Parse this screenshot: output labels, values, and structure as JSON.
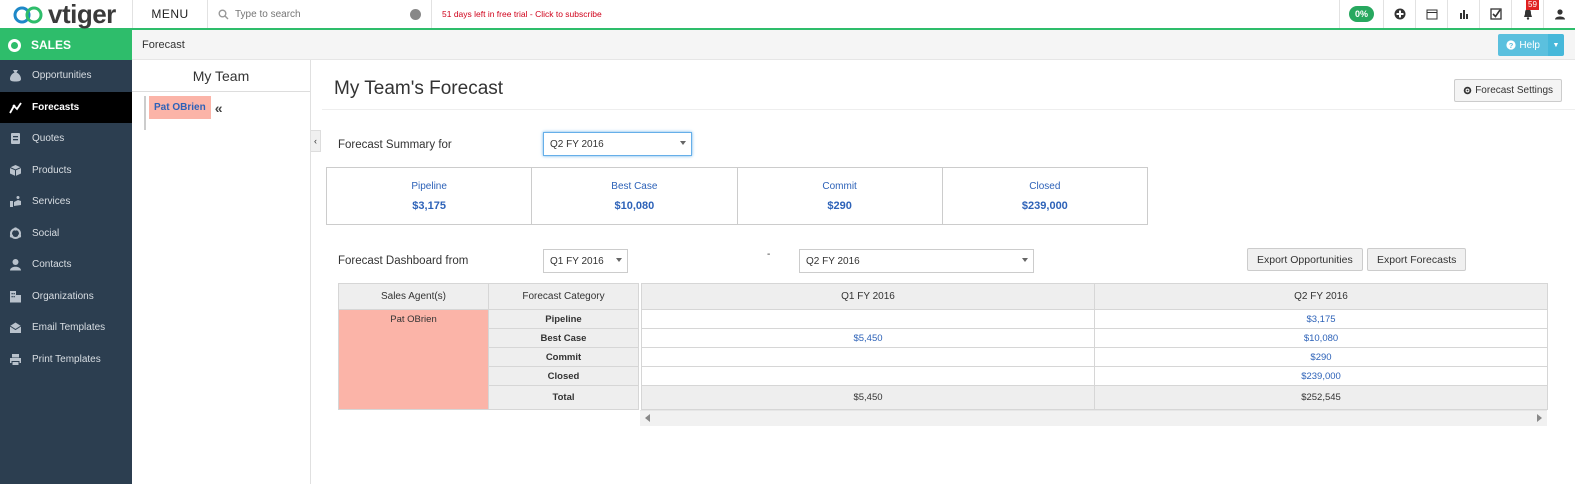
{
  "app": {
    "logo_text": "vtiger",
    "menu_label": "MENU"
  },
  "search": {
    "placeholder": "Type to search"
  },
  "trial": {
    "text": "51 days left in free trial - Click to subscribe"
  },
  "toolbar": {
    "progress": "0%",
    "notifications": "59"
  },
  "sidebar": {
    "module": "SALES",
    "items": [
      {
        "label": "Opportunities",
        "icon": "money-bag-icon",
        "active": false
      },
      {
        "label": "Forecasts",
        "icon": "forecast-icon",
        "active": true
      },
      {
        "label": "Quotes",
        "icon": "quote-icon",
        "active": false
      },
      {
        "label": "Products",
        "icon": "box-icon",
        "active": false
      },
      {
        "label": "Services",
        "icon": "service-icon",
        "active": false
      },
      {
        "label": "Social",
        "icon": "social-icon",
        "active": false
      },
      {
        "label": "Contacts",
        "icon": "contact-icon",
        "active": false
      },
      {
        "label": "Organizations",
        "icon": "building-icon",
        "active": false
      },
      {
        "label": "Email Templates",
        "icon": "email-icon",
        "active": false
      },
      {
        "label": "Print Templates",
        "icon": "printer-icon",
        "active": false
      }
    ]
  },
  "breadcrumb": {
    "current": "Forecast"
  },
  "help": {
    "label": "Help"
  },
  "team": {
    "title": "My Team",
    "member": "Pat OBrien"
  },
  "main": {
    "title": "My Team's Forecast",
    "settings_label": "Forecast Settings",
    "summary_label": "Forecast Summary for",
    "summary_period": "Q2 FY 2016",
    "summary": [
      {
        "label": "Pipeline",
        "value": "$3,175"
      },
      {
        "label": "Best Case",
        "value": "$10,080"
      },
      {
        "label": "Commit",
        "value": "$290"
      },
      {
        "label": "Closed",
        "value": "$239,000"
      }
    ],
    "dashboard_label": "Forecast Dashboard from",
    "dashboard_from": "Q1 FY 2016",
    "dashboard_sep": "-",
    "dashboard_to": "Q2 FY 2016",
    "export_opps": "Export Opportunities",
    "export_forecasts": "Export Forecasts"
  },
  "table": {
    "headers": [
      "Sales Agent(s)",
      "Forecast Category",
      "Q1 FY 2016",
      "Q2 FY 2016"
    ],
    "agent": "Pat OBrien",
    "rows": [
      {
        "category": "Pipeline",
        "q1": "",
        "q2": "$3,175"
      },
      {
        "category": "Best Case",
        "q1": "$5,450",
        "q2": "$10,080"
      },
      {
        "category": "Commit",
        "q1": "",
        "q2": "$290"
      },
      {
        "category": "Closed",
        "q1": "",
        "q2": "$239,000"
      }
    ],
    "total": {
      "label": "Total",
      "q1": "$5,450",
      "q2": "$252,545"
    }
  }
}
